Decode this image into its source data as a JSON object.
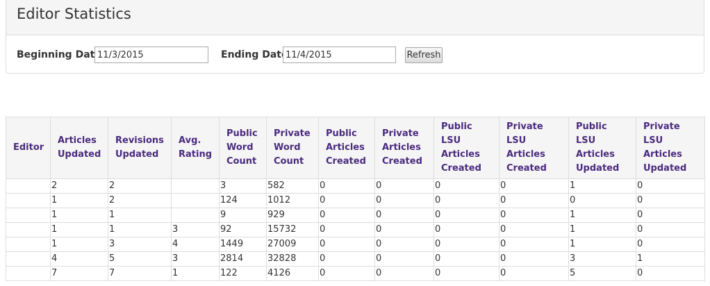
{
  "header": {
    "title": "Editor Statistics"
  },
  "filters": {
    "beginning_label": "Beginning Date",
    "beginning_value": "11/3/2015",
    "ending_label": "Ending Date",
    "ending_value": "11/4/2015",
    "refresh_label": "Refresh"
  },
  "table": {
    "headers": [
      "Editor",
      "Articles Updated",
      "Revisions Updated",
      "Avg. Rating",
      "Public Word Count",
      "Private Word Count",
      "Public Articles Created",
      "Private Articles Created",
      "Public LSU Articles Created",
      "Private LSU Articles Created",
      "Public LSU Articles Updated",
      "Private LSU Articles Updated"
    ],
    "rows": [
      [
        "",
        "2",
        "2",
        "",
        "3",
        "582",
        "0",
        "0",
        "0",
        "0",
        "1",
        "0"
      ],
      [
        "",
        "1",
        "2",
        "",
        "124",
        "1012",
        "0",
        "0",
        "0",
        "0",
        "0",
        "0"
      ],
      [
        "",
        "1",
        "1",
        "",
        "9",
        "929",
        "0",
        "0",
        "0",
        "0",
        "1",
        "0"
      ],
      [
        "",
        "1",
        "1",
        "3",
        "92",
        "15732",
        "0",
        "0",
        "0",
        "0",
        "1",
        "0"
      ],
      [
        "",
        "1",
        "3",
        "4",
        "1449",
        "27009",
        "0",
        "0",
        "0",
        "0",
        "1",
        "0"
      ],
      [
        "",
        "4",
        "5",
        "3",
        "2814",
        "32828",
        "0",
        "0",
        "0",
        "0",
        "3",
        "1"
      ],
      [
        "",
        "7",
        "7",
        "1",
        "122",
        "4126",
        "0",
        "0",
        "0",
        "0",
        "5",
        "0"
      ]
    ]
  }
}
